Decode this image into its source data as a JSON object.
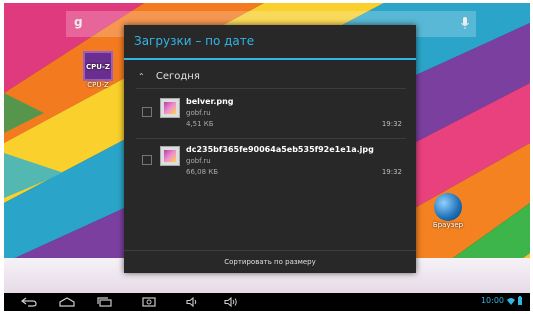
{
  "search": {
    "logo": "g"
  },
  "desktop": {
    "cpuz": {
      "tile_text": "CPU-Z",
      "label": "CPU-Z"
    },
    "browser": {
      "label": "Браузер"
    }
  },
  "dialog": {
    "title": "Загрузки – по дате",
    "group_header": "Сегодня",
    "items": [
      {
        "name": "belver.png",
        "source": "gobf.ru",
        "size": "4,51 КБ",
        "time": "19:32"
      },
      {
        "name": "dc235bf365fe90064a5eb535f92e1e1a.jpg",
        "source": "gobf.ru",
        "size": "66,08 КБ",
        "time": "19:32"
      }
    ],
    "sort_button": "Сортировать по размеру"
  },
  "statusbar": {
    "time": "10:00"
  },
  "colors": {
    "accent": "#33b5e5",
    "dialog_bg": "#282828",
    "navbar_bg": "#000000"
  }
}
